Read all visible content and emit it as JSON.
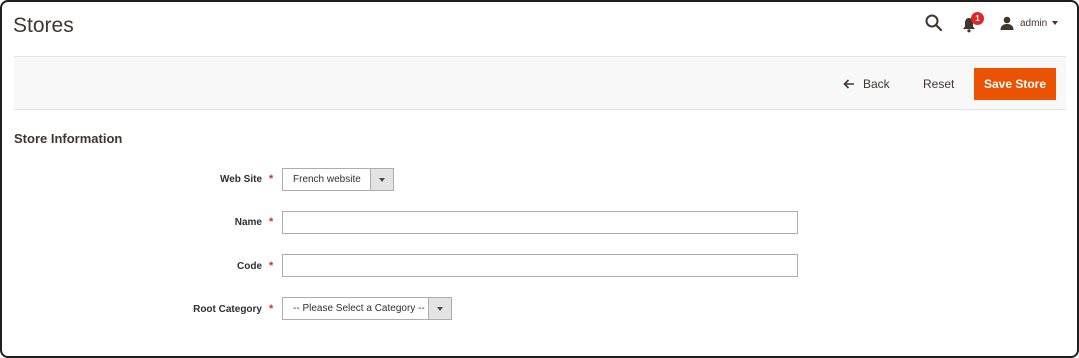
{
  "header": {
    "title": "Stores",
    "notification_count": "1",
    "user_name": "admin"
  },
  "action_bar": {
    "back_label": "Back",
    "reset_label": "Reset",
    "save_label": "Save Store"
  },
  "section": {
    "title": "Store Information"
  },
  "form": {
    "website": {
      "label": "Web Site",
      "required": "*",
      "value": "French website"
    },
    "name": {
      "label": "Name",
      "required": "*",
      "value": ""
    },
    "code": {
      "label": "Code",
      "required": "*",
      "value": ""
    },
    "root_category": {
      "label": "Root Category",
      "required": "*",
      "value": "-- Please Select a Category --"
    }
  },
  "colors": {
    "accent": "#eb5202",
    "required": "#e22626",
    "text": "#41362f"
  }
}
